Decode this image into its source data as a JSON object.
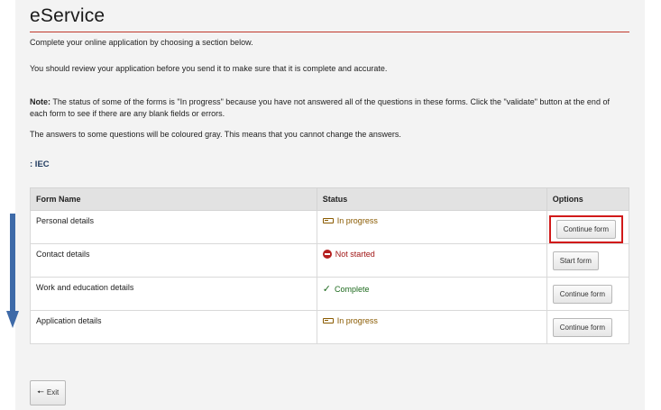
{
  "page": {
    "title": "eService",
    "intro": "Complete your online application by choosing a section below.",
    "review": "You should review your application before you send it to make sure that it is complete and accurate.",
    "note_label": "Note:",
    "note_text": " The status of some of the forms is \"In progress\" because you have not answered all of the questions in these forms. Click the \"validate\" button at the end of each form to see if there are any blank fields or errors.",
    "gray_note": "The answers to some questions will be coloured gray. This means that you cannot change the answers.",
    "section_label": ": IEC"
  },
  "table": {
    "headers": {
      "name": "Form Name",
      "status": "Status",
      "options": "Options"
    },
    "rows": [
      {
        "name": "Personal details",
        "status": "In progress",
        "status_kind": "progress",
        "button": "Continue form"
      },
      {
        "name": "Contact details",
        "status": "Not started",
        "status_kind": "not-started",
        "button": "Start form"
      },
      {
        "name": "Work and education details",
        "status": "Complete",
        "status_kind": "complete",
        "button": "Continue form"
      },
      {
        "name": "Application details",
        "status": "In progress",
        "status_kind": "progress",
        "button": "Continue form"
      }
    ]
  },
  "footer": {
    "exit_label": "Exit",
    "exit_icon": "arrow-left-icon"
  },
  "colors": {
    "accent_rule": "#c0392b",
    "highlight_box": "#d11a1a",
    "in_progress": "#8a5a00",
    "not_started": "#a01515",
    "complete": "#1f6b1f",
    "annotation_arrow": "#3e6aa8"
  }
}
